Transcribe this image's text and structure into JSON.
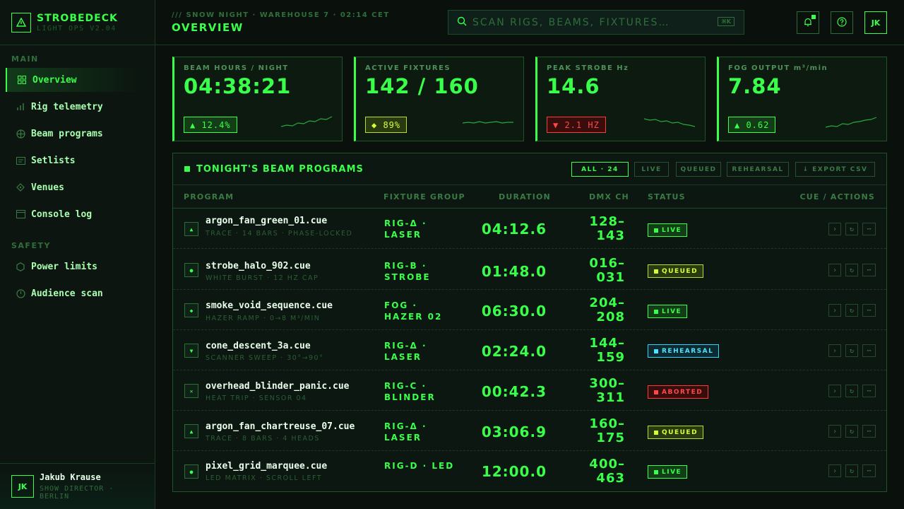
{
  "brand": {
    "name": "STROBEDECK",
    "version": "LIGHT OPS V2.04"
  },
  "sidebar": {
    "main_label": "MAIN",
    "safety_label": "SAFETY",
    "main_items": [
      {
        "label": "Overview",
        "icon": "grid-icon",
        "active": true
      },
      {
        "label": "Rig telemetry",
        "icon": "bars-icon"
      },
      {
        "label": "Beam programs",
        "icon": "crosshair-icon"
      },
      {
        "label": "Setlists",
        "icon": "list-icon"
      },
      {
        "label": "Venues",
        "icon": "diamond-icon"
      },
      {
        "label": "Console log",
        "icon": "window-icon"
      }
    ],
    "safety_items": [
      {
        "label": "Power limits",
        "icon": "hexagon-icon"
      },
      {
        "label": "Audience scan",
        "icon": "clock-icon"
      }
    ],
    "user": {
      "initials": "JK",
      "name": "Jakub Krause",
      "role": "SHOW DIRECTOR · BERLIN"
    }
  },
  "topbar": {
    "breadcrumb": "/// SNOW NIGHT · WAREHOUSE 7 · 02:14 CET",
    "title": "OVERVIEW",
    "search_placeholder": "SCAN RIGS, BEAMS, FIXTURES…",
    "search_shortcut": "⌘K",
    "user_initials": "JK"
  },
  "kpis": [
    {
      "label": "BEAM HOURS / NIGHT",
      "value": "04:38:21",
      "delta": "▲ 12.4%",
      "trend": "up"
    },
    {
      "label": "ACTIVE FIXTURES",
      "value": "142 / 160",
      "delta": "◆ 89%",
      "trend": "flat"
    },
    {
      "label": "PEAK STROBE Hz",
      "value": "14.6",
      "delta": "▼ 2.1 HZ",
      "trend": "down"
    },
    {
      "label": "FOG OUTPUT m³/min",
      "value": "7.84",
      "delta": "▲ 0.62",
      "trend": "up"
    }
  ],
  "programs": {
    "title": "TONIGHT'S BEAM PROGRAMS",
    "filters": [
      "ALL · 24",
      "LIVE",
      "QUEUED",
      "REHEARSAL",
      "↓ EXPORT CSV"
    ],
    "columns": [
      "PROGRAM",
      "FIXTURE GROUP",
      "DURATION",
      "DMX CH",
      "STATUS",
      "CUE / ACTIONS"
    ],
    "rows": [
      {
        "icon": "▲",
        "name": "argon_fan_green_01.cue",
        "desc": "TRACE · 14 BARS · PHASE-LOCKED",
        "group": "RIG-Δ · LASER",
        "duration": "04:12.6",
        "dmx": "128–143",
        "status": "LIVE",
        "status_kind": "live"
      },
      {
        "icon": "●",
        "name": "strobe_halo_902.cue",
        "desc": "WHITE BURST · 12 HZ CAP",
        "group": "RIG-B · STROBE",
        "duration": "01:48.0",
        "dmx": "016–031",
        "status": "QUEUED",
        "status_kind": "queued"
      },
      {
        "icon": "◆",
        "name": "smoke_void_sequence.cue",
        "desc": "HAZER RAMP · 0→8 M³/MIN",
        "group": "FOG · HAZER 02",
        "duration": "06:30.0",
        "dmx": "204–208",
        "status": "LIVE",
        "status_kind": "live"
      },
      {
        "icon": "▼",
        "name": "cone_descent_3a.cue",
        "desc": "SCANNER SWEEP · 30°→90°",
        "group": "RIG-Δ · LASER",
        "duration": "02:24.0",
        "dmx": "144–159",
        "status": "REHEARSAL",
        "status_kind": "rehearsal"
      },
      {
        "icon": "✕",
        "name": "overhead_blinder_panic.cue",
        "desc": "HEAT TRIP · SENSOR 04",
        "group": "RIG-C · BLINDER",
        "duration": "00:42.3",
        "dmx": "300–311",
        "status": "ABORTED",
        "status_kind": "aborted"
      },
      {
        "icon": "▲",
        "name": "argon_fan_chartreuse_07.cue",
        "desc": "TRACE · 8 BARS · 4 HEADS",
        "group": "RIG-Δ · LASER",
        "duration": "03:06.9",
        "dmx": "160–175",
        "status": "QUEUED",
        "status_kind": "queued"
      },
      {
        "icon": "●",
        "name": "pixel_grid_marquee.cue",
        "desc": "LED MATRIX · SCROLL LEFT",
        "group": "RIG-D · LED",
        "duration": "12:00.0",
        "dmx": "400–463",
        "status": "LIVE",
        "status_kind": "live"
      }
    ]
  },
  "colors": {
    "accent": "#39ff4a",
    "queued": "#d6ff3a",
    "rehearsal": "#4ae6ff",
    "aborted": "#ff4a4a"
  }
}
